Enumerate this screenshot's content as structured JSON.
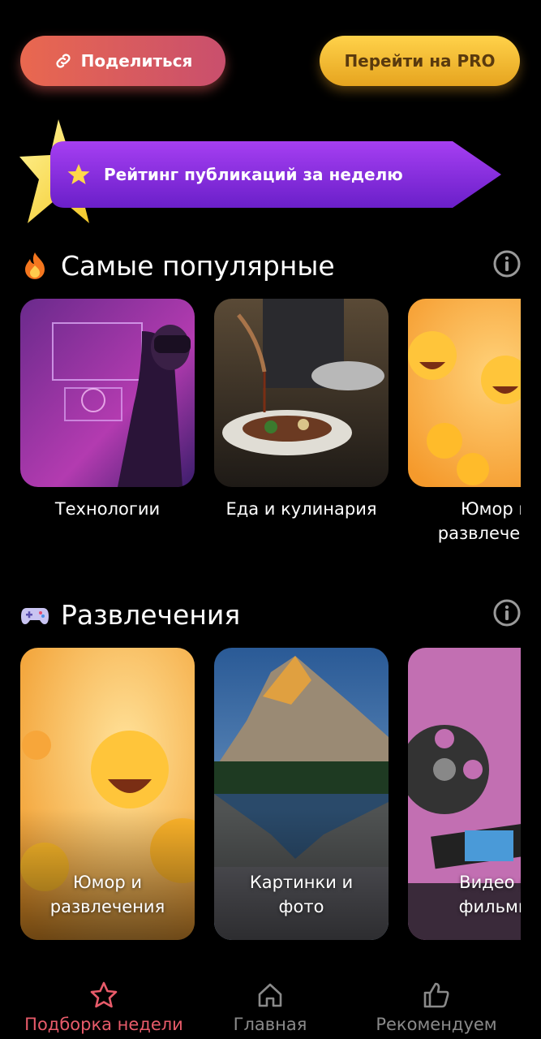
{
  "header": {
    "share_label": "Поделиться",
    "pro_label": "Перейти на PRO"
  },
  "banner": {
    "label": "Рейтинг публикаций за неделю"
  },
  "sections": [
    {
      "title": "Самые популярные",
      "icon": "fire-icon",
      "cards": [
        {
          "label": "Технологии"
        },
        {
          "label": "Еда и кулинария"
        },
        {
          "label_line1": "Юмор и",
          "label_line2": "развлечения"
        }
      ]
    },
    {
      "title": "Развлечения",
      "icon": "gamepad-icon",
      "cards": [
        {
          "label_line1": "Юмор и",
          "label_line2": "развлечения"
        },
        {
          "label_line1": "Картинки и",
          "label_line2": "фото"
        },
        {
          "label_line1": "Видео и",
          "label_line2": "фильмы"
        }
      ]
    }
  ],
  "bottom_nav": {
    "items": [
      {
        "label": "Подборка недели",
        "icon": "star-icon",
        "active": true
      },
      {
        "label": "Главная",
        "icon": "home-icon",
        "active": false
      },
      {
        "label": "Рекомендуем",
        "icon": "thumbs-up-icon",
        "active": false
      }
    ]
  },
  "colors": {
    "accent_active": "#e85b6a",
    "inactive": "#8a8a8a",
    "share_gradient_start": "#e9684f",
    "pro_gradient_start": "#ffd24a",
    "banner_purple": "#8a2be2"
  }
}
